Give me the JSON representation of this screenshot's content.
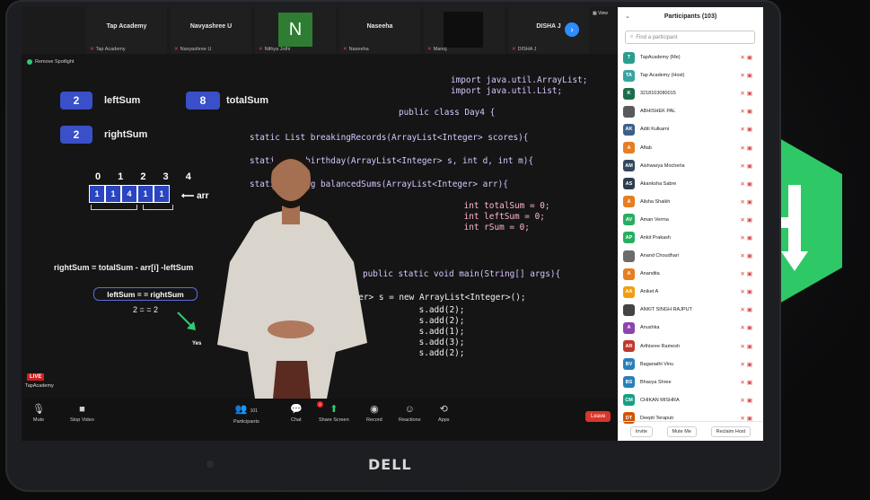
{
  "tiles": [
    {
      "name": "Tap Academy",
      "label": "Tap Academy"
    },
    {
      "name": "Navyashree U",
      "label": "Navyashree U"
    },
    {
      "name": "N",
      "label": "Nithya Jothi"
    },
    {
      "name": "Naseeha",
      "label": "Naseeha"
    },
    {
      "name": "",
      "label": "Manoj"
    },
    {
      "name": "DISHA J",
      "label": "DISHA J"
    }
  ],
  "view_label": "View",
  "spotlight_label": "Remove Spotlight",
  "board": {
    "leftsum_value": "2",
    "leftsum_label": "leftSum",
    "totalsum_value": "8",
    "totalsum_label": "totalSum",
    "rightsum_value": "2",
    "rightsum_label": "rightSum",
    "indices": "0 1 2 3 4",
    "array": [
      "1",
      "1",
      "4",
      "1",
      "1"
    ],
    "arr_label": "arr",
    "equation": "rightSum = totalSum - arr[i] -leftSum",
    "condition": "leftSum = = rightSum",
    "result": "2 = = 2",
    "yes": "Yes"
  },
  "code_lines": [
    "import java.util.ArrayList;",
    "import java.util.List;",
    "",
    "public class Day4 {",
    "",
    "static List breakingRecords(ArrayList<Integer> scores){",
    "",
    "static int birthday(ArrayList<Integer> s, int d, int m){",
    "",
    "static String balancedSums(ArrayList<Integer> arr){",
    "",
    "    int totalSum = 0;",
    "    int leftSum = 0;",
    "    int rSum = 0;",
    "",
    "",
    "",
    "public static void main(String[] args){",
    "",
    "    ArrayList<Integer> s = new ArrayList<Integer>();",
    "    s.add(2);",
    "    s.add(2);",
    "    s.add(1);",
    "    s.add(3);",
    "    s.add(2);"
  ],
  "live_label": "LIVE",
  "live_brand": "TapAcademy",
  "toolbar": {
    "mute": "Mute",
    "stop_video": "Stop Video",
    "participants": "Participants",
    "participants_count": "101",
    "chat": "Chat",
    "chat_badge": "2",
    "share_screen": "Share Screen",
    "record": "Record",
    "reactions": "Reactions",
    "apps": "Apps",
    "leave": "Leave"
  },
  "panel": {
    "title": "Participants (103)",
    "search_placeholder": "Find a participant",
    "participants": [
      {
        "initials": "T",
        "name": "TapAcademy (Me)",
        "color": "#2a9d8f"
      },
      {
        "initials": "TA",
        "name": "Tap Academy (Host)",
        "color": "#3aa3a0"
      },
      {
        "initials": "K",
        "name": "3218103080015",
        "color": "#1b6e4b"
      },
      {
        "initials": "",
        "name": "ABHISHEK PAL",
        "color": "#5a5a5a"
      },
      {
        "initials": "AK",
        "name": "Aditi Kulkarni",
        "color": "#3e5f8a"
      },
      {
        "initials": "A",
        "name": "Aftab",
        "color": "#e67e22"
      },
      {
        "initials": "AM",
        "name": "Aishwarya Mocherla",
        "color": "#34495e"
      },
      {
        "initials": "AS",
        "name": "Akanksha Sabre",
        "color": "#2c3e50"
      },
      {
        "initials": "A",
        "name": "Alisha Shaikh",
        "color": "#e67e22"
      },
      {
        "initials": "AV",
        "name": "Aman Verma",
        "color": "#27ae60"
      },
      {
        "initials": "AP",
        "name": "Ankit Prakash",
        "color": "#27ae60"
      },
      {
        "initials": "",
        "name": "Anand Choudhari",
        "color": "#6b6b6b"
      },
      {
        "initials": "A",
        "name": "Anandita",
        "color": "#e67e22"
      },
      {
        "initials": "AA",
        "name": "Aniket A",
        "color": "#f39c12"
      },
      {
        "initials": "",
        "name": "ANKIT SINGH RAJPUT",
        "color": "#444444"
      },
      {
        "initials": "A",
        "name": "Anushka",
        "color": "#8e44ad"
      },
      {
        "initials": "AR",
        "name": "Arthisree Ramesh",
        "color": "#c0392b"
      },
      {
        "initials": "BV",
        "name": "Baganathi Vinu",
        "color": "#2980b9"
      },
      {
        "initials": "BS",
        "name": "Bhavya Shree",
        "color": "#2980b9"
      },
      {
        "initials": "CM",
        "name": "CHIKAN MISHRA",
        "color": "#16a085"
      },
      {
        "initials": "DT",
        "name": "Deepti Teraputi",
        "color": "#d35400"
      }
    ],
    "invite": "Invite",
    "mute_me": "Mute Me",
    "reclaim_host": "Reclaim Host"
  },
  "laptop_brand": "DELL",
  "colors": {
    "accent_blue": "#2d8cff",
    "board_pill": "#3a50c8",
    "logo_green": "#2ec866",
    "leave_red": "#d9362b"
  }
}
